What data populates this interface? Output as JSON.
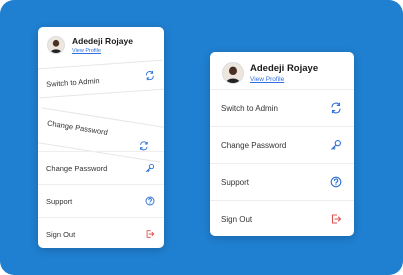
{
  "colors": {
    "background": "#1f7fd0",
    "card": "#ffffff",
    "link": "#2f6fdf",
    "icon_blue": "#2a6fd6",
    "icon_red": "#e2504d"
  },
  "left_card": {
    "user": {
      "name": "Adedeji Rojaye",
      "profile_link": "View Profile"
    },
    "items": [
      {
        "label": "Switch to Admin",
        "icon": "switch-icon"
      },
      {
        "label": "Change Password",
        "icon": "switch-icon"
      },
      {
        "label": "Change Password",
        "icon": "key-icon"
      },
      {
        "label": "Support",
        "icon": "help-icon"
      },
      {
        "label": "Sign Out",
        "icon": "logout-icon"
      }
    ]
  },
  "right_card": {
    "user": {
      "name": "Adedeji Rojaye",
      "profile_link": "View Profile"
    },
    "items": [
      {
        "label": "Switch to Admin",
        "icon": "switch-icon"
      },
      {
        "label": "Change Password",
        "icon": "key-icon"
      },
      {
        "label": "Support",
        "icon": "help-icon"
      },
      {
        "label": "Sign Out",
        "icon": "logout-icon"
      }
    ]
  }
}
